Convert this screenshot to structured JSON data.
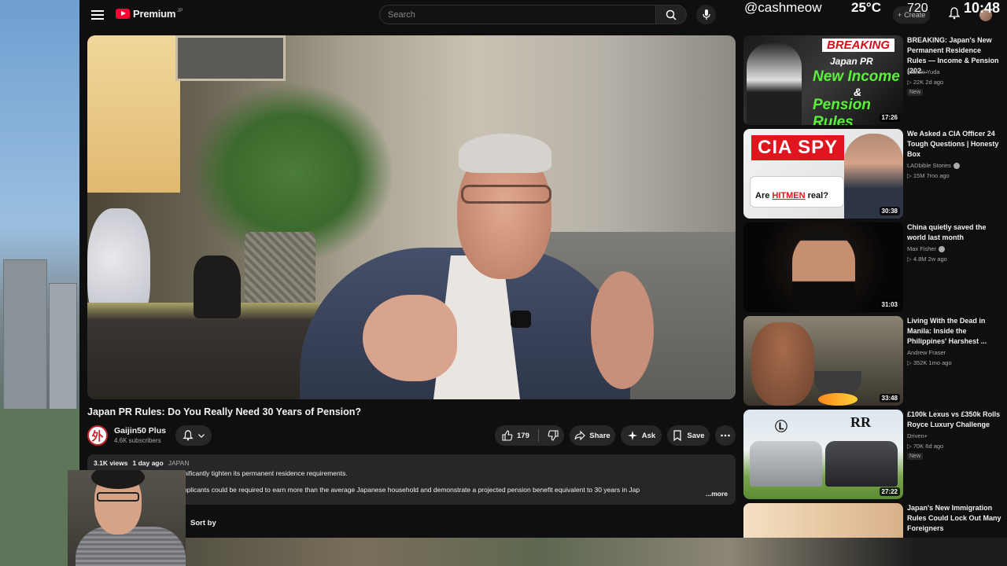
{
  "header": {
    "logo_text": "Premium",
    "logo_region": "JP",
    "search_placeholder": "Search",
    "create_label": "Create"
  },
  "overlay": {
    "handle": "@cashmeow",
    "temperature": "25°C",
    "number": "720",
    "time": "10:48"
  },
  "video": {
    "title": "Japan PR Rules: Do You Really Need 30 Years of Pension?",
    "channel": "Gaijin50 Plus",
    "channel_avatar_char": "外",
    "subscribers": "4.6K subscribers",
    "likes": "179",
    "share_label": "Share",
    "ask_label": "Ask",
    "save_label": "Save"
  },
  "description": {
    "views": "3.1K views",
    "age": "1 day ago",
    "tag": "JAPAN",
    "line1": "Japan may be preparing to significantly tighten its permanent residence requirements.",
    "line2": "Reports claim that future PR applicants could be required to earn more than the average Japanese household and demonstrate a projected pension benefit equivalent to 30 years in Jap",
    "more_label": "...more"
  },
  "comments": {
    "sort_label": "Sort by"
  },
  "sidebar": {
    "items": [
      {
        "title": "BREAKING: Japan's New Permanent Residence Rules — Income & Pension (202...",
        "channel": "Kazuki Yuda",
        "stats": "22K  2d ago",
        "badge": "New",
        "duration": "17:26",
        "thumb_text": [
          "BREAKING",
          "Japan PR",
          "New Income",
          "&",
          "Pension Rules"
        ]
      },
      {
        "title": "We Asked a CIA Officer 24 Tough Questions | Honesty Box",
        "channel": "LADbible Stories",
        "stats": "15M  7mo ago",
        "duration": "30:38",
        "thumb_text": [
          "CIA SPY",
          "Are",
          "HITMEN",
          "real?"
        ]
      },
      {
        "title": "China quietly saved the world last month",
        "channel": "Max Fisher",
        "stats": "4.8M  2w ago",
        "duration": "31:03"
      },
      {
        "title": "Living With the Dead in Manila: Inside the Philippines' Harshest ...",
        "channel": "Andrew Fraser",
        "stats": "352K  1mo ago",
        "duration": "33:48"
      },
      {
        "title": "£100k Lexus vs £350k Rolls Royce Luxury Challenge",
        "channel": "Driven+",
        "stats": "70K  6d ago",
        "badge": "New",
        "duration": "27:22"
      },
      {
        "title": "Japan's New Immigration Rules Could Lock Out Many Foreigners"
      }
    ]
  },
  "colors": {
    "background": "#0f0f0f",
    "accent": "#ff0033",
    "pill": "#272727"
  }
}
